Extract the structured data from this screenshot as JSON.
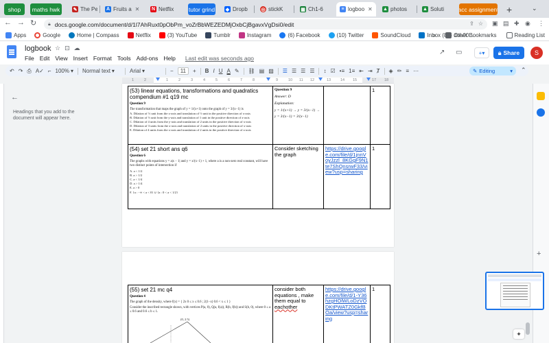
{
  "tabs": [
    {
      "label": "shop",
      "type": "group",
      "color": "#1e8e3e"
    },
    {
      "label": "maths hwk",
      "type": "group",
      "color": "#1e8e3e"
    },
    {
      "label": "The Pe",
      "type": "tab",
      "icon": "pen-icon",
      "color": "#c5221f"
    },
    {
      "label": "Fruits a",
      "type": "tab",
      "icon": "a-icon",
      "color": "#1a73e8"
    },
    {
      "label": "Netflix",
      "type": "tab",
      "icon": "netflix-icon",
      "color": "#e50914"
    },
    {
      "label": "tutor grind",
      "type": "group",
      "color": "#1a73e8"
    },
    {
      "label": "Dropb",
      "type": "tab",
      "icon": "dropbox-icon",
      "color": "#0061ff"
    },
    {
      "label": "stickK",
      "type": "tab",
      "icon": "stickk-icon",
      "color": "#d93025"
    },
    {
      "label": "Ch1-6",
      "type": "tab",
      "icon": "sheet-icon",
      "color": "#188038"
    },
    {
      "label": "logboo",
      "type": "active",
      "icon": "docs-icon",
      "color": "#4285f4"
    },
    {
      "label": "photos",
      "type": "tab",
      "icon": "drive-icon",
      "color": "#1e8e3e"
    },
    {
      "label": "Soluti",
      "type": "tab",
      "icon": "drive-icon",
      "color": "#1e8e3e"
    },
    {
      "label": "acc assignment",
      "type": "group",
      "color": "#e37400"
    }
  ],
  "address": {
    "url": "docs.google.com/document/d/1l7AhRuxt0pObPm_voZrBbWEZEDMjOxbCjBgavxVgDsi0/edit"
  },
  "bookmarks": {
    "items": [
      "Apps",
      "Google",
      "Home | Compass",
      "Netflix",
      "(3) YouTube",
      "Tumblr",
      "Instagram",
      "(6) Facebook",
      "(10) Twitter",
      "SoundCloud",
      "Inbox (8) - doa00..."
    ],
    "other": "Other Bookmarks",
    "reading": "Reading List",
    "more": "»"
  },
  "doc": {
    "title": "logbook",
    "menu": [
      "File",
      "Edit",
      "View",
      "Insert",
      "Format",
      "Tools",
      "Add-ons",
      "Help"
    ],
    "last_edit": "Last edit was seconds ago",
    "share": "Share",
    "avatar_initial": "S"
  },
  "format_toolbar": {
    "zoom": "100%",
    "style": "Normal text",
    "font": "Arial",
    "font_size": "11",
    "mode": "Editing"
  },
  "ruler": {
    "ticks": [
      "1",
      "2",
      "1",
      "2",
      "3",
      "4",
      "5",
      "6",
      "7",
      "8",
      "9",
      "10",
      "11",
      "12",
      "13",
      "14",
      "15",
      "16",
      "17",
      "18"
    ]
  },
  "outline": {
    "hint": "Headings that you add to the document will appear here."
  },
  "rows": [
    {
      "title": "(53) linear equations, transformations and quadratics compendium #1 q19 mc",
      "q_label": "Question 9",
      "q_text": "The transformation that maps the graph of  y = 1/(x+1)  onto the graph of  y = 3/(x−1)  is",
      "q_options": [
        "A.  Dilation of ⅓ unit from the x-axis and translation of ½ unit in the positive direction of x-axis",
        "B.  Dilation of ⅓ unit from the y-axis and translation of 1 unit in the positive direction of x-axis",
        "C.  Dilation of 4 units from the y-axis and translation of 2 units in the positive direction of x-axis",
        "D.  Dilation of 3 units from the x-axis and translation of 2 units in the positive direction of x-axis",
        "E.  Dilation of 4 units from the x-axis and translation of 2 units in the positive direction of x-axis"
      ],
      "answer_label": "Question 9",
      "answer": "Answer: D",
      "explanation": "Explanation:",
      "formula": "y = 1/(x+1) → y = 3/(x−1) → y = 3/(x−1) = 3/(x−1)",
      "link": "",
      "mark": "1"
    },
    {
      "title": "(54) set 21 short ans q6",
      "q_label": "Question 6",
      "q_text": "The graphs with equations  y = a|x − 1|  and  y = x/(x−1) + 1,  where a is a non-zero real constant, will have two distinct points of intersection if",
      "q_options": [
        "A.  a < 1/2",
        "B.  a > 1/2",
        "C.  a < 1/4",
        "D.  a > 1/4",
        "E.  a > 0",
        "F.  {a : −∞ < a < 0} ∪ {a : 0 < a < 1/2}"
      ],
      "note": "Consider sketching the graph",
      "link": "https://drive.google.com/file/d/1jnnVoyJzzl_8KGgF9N1te7ShQnsrwF33/view?usp=sharing",
      "mark": "1"
    },
    {
      "title": "(55) set 21 mc q4",
      "q_label": "Question 4",
      "q_text": "The graph of the density, where f(x) = { 2x  0 ≤ x ≤ 0.6 ; 2(1−x)  0.6 < x ≤ 1 }",
      "q_extra": "Consider the inscribed rectangle shown, with vertices P(a, 0), Q(a, f(a)), R(b, f(b)) and S(b, 0), where 0 ≤ a ≤ 0.6 and 0.6 ≤ b ≤ 1.",
      "graph_label": "(0, 2.5)",
      "note_parts": [
        "consider both equations , make them equal to ",
        "eachother"
      ],
      "link": "https://drive.google.com/file/d/1-Y36hzgHOlWLoDzVODKtPWATZ0GkfBOa/view?usp=sharing",
      "mark": "1"
    }
  ],
  "colors": {
    "accent": "#1a73e8",
    "docs_blue": "#4285f4",
    "link": "#1155cc"
  }
}
